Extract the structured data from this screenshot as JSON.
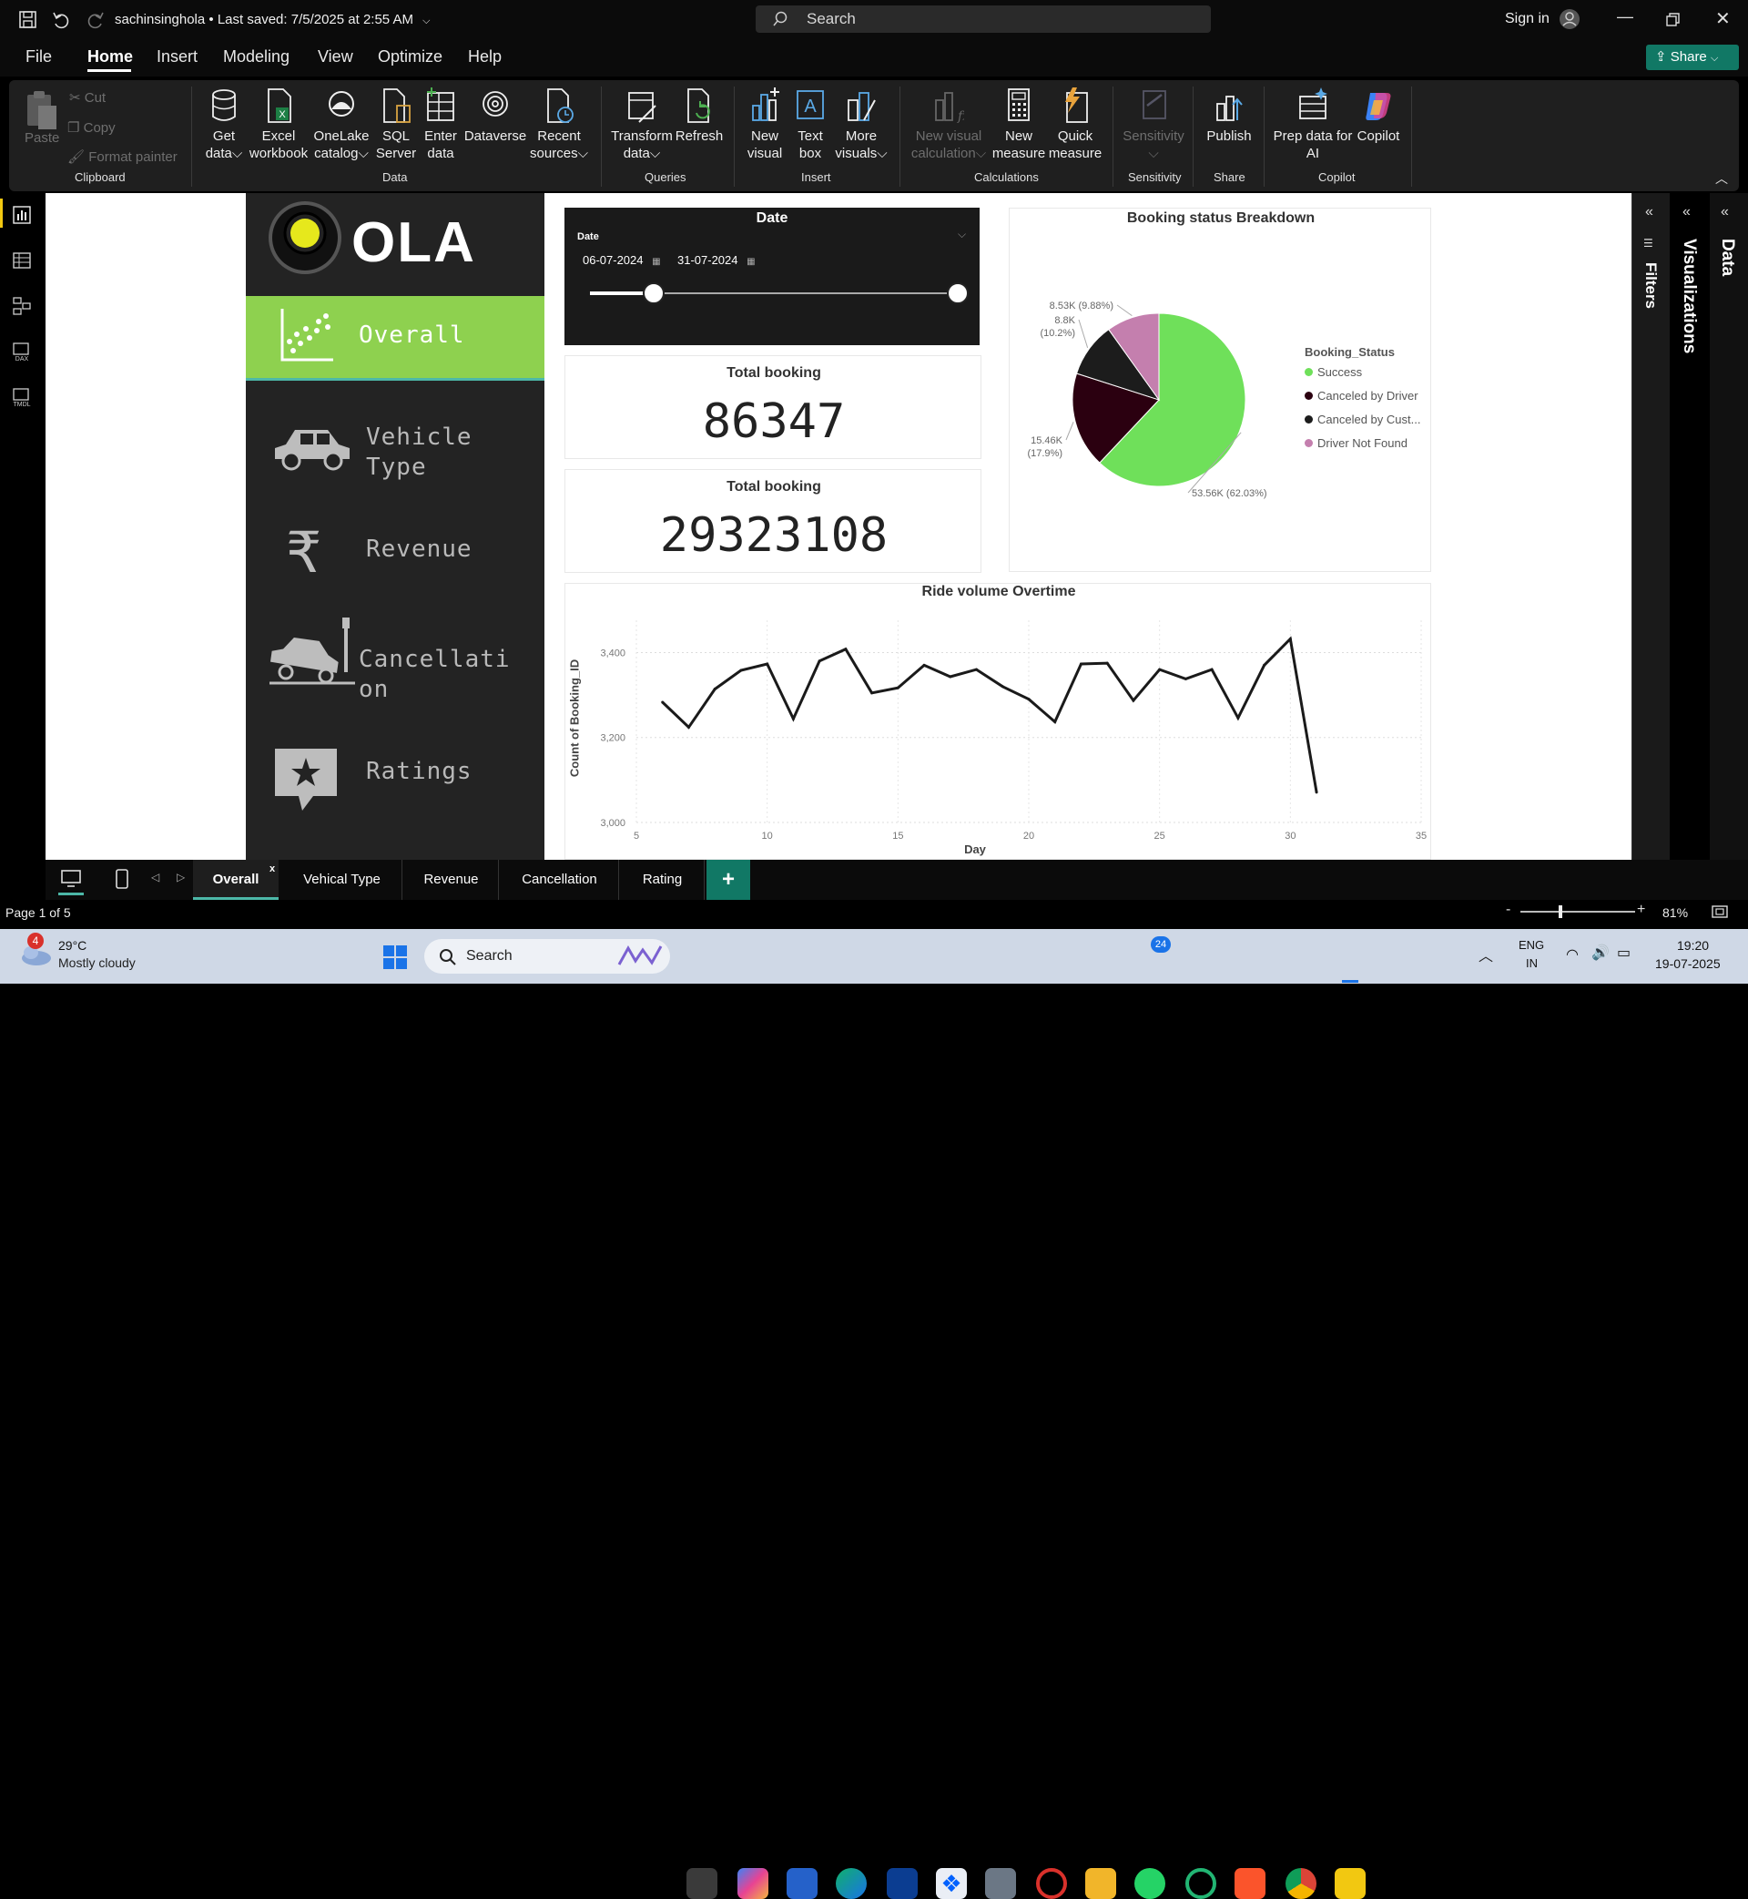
{
  "title": {
    "filename": "sachinsinghola",
    "saved": "Last saved: 7/5/2025 at 2:55 AM",
    "search": "Search",
    "signin": "Sign in"
  },
  "menu": {
    "file": "File",
    "home": "Home",
    "insert": "Insert",
    "modeling": "Modeling",
    "view": "View",
    "optimize": "Optimize",
    "help": "Help",
    "share": "Share"
  },
  "ribbon": {
    "paste": "Paste",
    "cut": "Cut",
    "copy": "Copy",
    "format_painter": "Format painter",
    "clipboard": "Clipboard",
    "get_data": [
      "Get",
      "data"
    ],
    "excel": [
      "Excel",
      "workbook"
    ],
    "onelake": [
      "OneLake",
      "catalog"
    ],
    "sql": [
      "SQL",
      "Server"
    ],
    "enter": [
      "Enter",
      "data"
    ],
    "dataverse": "Dataverse",
    "recent": [
      "Recent",
      "sources"
    ],
    "data": "Data",
    "transform": [
      "Transform",
      "data"
    ],
    "refresh": "Refresh",
    "queries": "Queries",
    "new_visual": [
      "New",
      "visual"
    ],
    "text_box": [
      "Text",
      "box"
    ],
    "more_visuals": [
      "More",
      "visuals"
    ],
    "insert": "Insert",
    "new_visual_calc": [
      "New visual",
      "calculation"
    ],
    "new_measure": [
      "New",
      "measure"
    ],
    "quick_measure": [
      "Quick",
      "measure"
    ],
    "calculations": "Calculations",
    "sensitivity": "Sensitivity",
    "sensitivity_group": "Sensitivity",
    "publish": "Publish",
    "share_group": "Share",
    "prep": [
      "Prep data for",
      "AI"
    ],
    "copilot": "Copilot",
    "copilot_group": "Copilot"
  },
  "nav": {
    "logo": "OLA",
    "overall": "Overall",
    "vehicle": [
      "Vehicle",
      "Type"
    ],
    "revenue": "Revenue",
    "cancellation": [
      "Cancellati",
      "on"
    ],
    "ratings": "Ratings"
  },
  "slicer": {
    "title": "Date",
    "field": "Date",
    "start": "06-07-2024",
    "end": "31-07-2024",
    "start_fraction": 0.17,
    "end_fraction": 1.0
  },
  "kpi1": {
    "label": "Total booking",
    "value": "86347"
  },
  "kpi2": {
    "label": "Total booking",
    "value": "29323108"
  },
  "panes": {
    "filters": "Filters",
    "visualizations": "Visualizations",
    "data": "Data"
  },
  "tabs": [
    "Overall",
    "Vehical Type",
    "Revenue",
    "Cancellation",
    "Rating"
  ],
  "status": {
    "page": "Page 1 of 5",
    "zoom": "81%"
  },
  "taskbar": {
    "temp": "29°C",
    "weather": "Mostly cloudy",
    "weather_badge": "4",
    "search": "Search",
    "whatsapp_badge": "24",
    "lang": "ENG",
    "region": "IN",
    "time": "19:20",
    "date": "19-07-2025"
  },
  "colors": {
    "accent_green": "#8ed14f",
    "success": "#6fe05a",
    "cancel_driver": "#2b0010",
    "cancel_cust": "#1c1c1c",
    "not_found": "#c47fae",
    "ribbon": "#1f1f1f",
    "nav_bg": "#232323"
  },
  "chart_data": [
    {
      "type": "pie",
      "title": "Booking status Breakdown",
      "legend_title": "Booking_Status",
      "legend_position": "right",
      "slices": [
        {
          "name": "Success",
          "value": 53560,
          "label": "53.56K (62.03%)"
        },
        {
          "name": "Canceled by Driver",
          "value": 15460,
          "label": "15.46K (17.9%)"
        },
        {
          "name": "Canceled by Cust...",
          "value": 8800,
          "label": "8.8K (10.2%)"
        },
        {
          "name": "Driver Not Found",
          "value": 8530,
          "label": "8.53K (9.88%)"
        }
      ]
    },
    {
      "type": "line",
      "title": "Ride volume Overtime",
      "xlabel": "Day",
      "ylabel": "Count of Booking_ID",
      "xlim": [
        5,
        35
      ],
      "ylim": [
        3000,
        3400
      ],
      "xticks": [
        5,
        10,
        15,
        20,
        25,
        30,
        35
      ],
      "yticks": [
        3000,
        3200,
        3400
      ],
      "grid": true,
      "x": [
        6,
        7,
        8,
        9,
        10,
        11,
        12,
        13,
        14,
        15,
        16,
        17,
        18,
        19,
        20,
        21,
        22,
        23,
        24,
        25,
        26,
        27,
        28,
        29,
        30,
        31
      ],
      "y": [
        3283,
        3224,
        3314,
        3358,
        3373,
        3244,
        3380,
        3408,
        3305,
        3317,
        3370,
        3343,
        3360,
        3320,
        3290,
        3237,
        3373,
        3375,
        3287,
        3360,
        3338,
        3360,
        3246,
        3370,
        3432,
        3071
      ]
    }
  ]
}
